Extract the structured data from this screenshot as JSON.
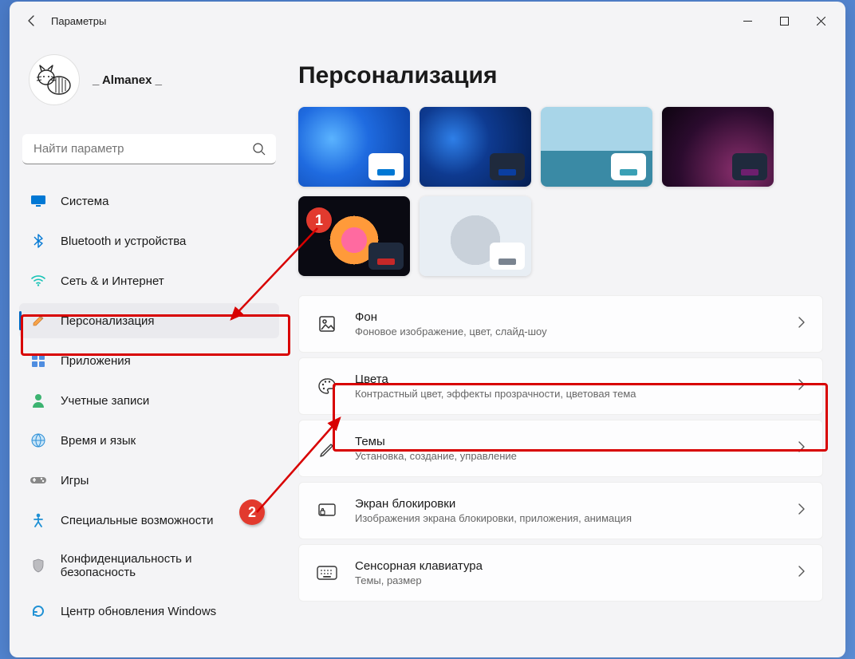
{
  "window": {
    "title": "Параметры",
    "username": "_ Almanex _"
  },
  "search": {
    "placeholder": "Найти параметр"
  },
  "sidebar": {
    "items": [
      {
        "label": "Система",
        "icon": "💻",
        "color": "#0078d4"
      },
      {
        "label": "Bluetooth и устройства",
        "icon": "bt"
      },
      {
        "label": "Сеть & и Интернет",
        "icon": "wifi"
      },
      {
        "label": "Персонализация",
        "icon": "brush"
      },
      {
        "label": "Приложения",
        "icon": "apps"
      },
      {
        "label": "Учетные записи",
        "icon": "user"
      },
      {
        "label": "Время и язык",
        "icon": "globe"
      },
      {
        "label": "Игры",
        "icon": "game"
      },
      {
        "label": "Специальные возможности",
        "icon": "access"
      },
      {
        "label": "Конфиденциальность и безопасность",
        "icon": "shield"
      },
      {
        "label": "Центр обновления Windows",
        "icon": "update"
      }
    ],
    "active_index": 3
  },
  "page": {
    "title": "Персонализация"
  },
  "themes": [
    {
      "bg": "bg-bloom",
      "taskbar": "light",
      "accent": "#0078d4"
    },
    {
      "bg": "bg-bloom-dark",
      "taskbar": "dark",
      "accent": "#0a3ea0"
    },
    {
      "bg": "bg-landscape",
      "taskbar": "light",
      "accent": "#3aa0b5"
    },
    {
      "bg": "bg-purple",
      "taskbar": "dark",
      "accent": "#6e1f6e"
    },
    {
      "bg": "bg-flower",
      "taskbar": "dark",
      "accent": "#c62828"
    },
    {
      "bg": "bg-abstract",
      "taskbar": "light",
      "accent": "#7a8490"
    }
  ],
  "settings": [
    {
      "title": "Фон",
      "sub": "Фоновое изображение, цвет, слайд-шоу",
      "icon": "image"
    },
    {
      "title": "Цвета",
      "sub": "Контрастный цвет, эффекты прозрачности, цветовая тема",
      "icon": "palette"
    },
    {
      "title": "Темы",
      "sub": "Установка, создание, управление",
      "icon": "pen"
    },
    {
      "title": "Экран блокировки",
      "sub": "Изображения экрана блокировки, приложения, анимация",
      "icon": "lock"
    },
    {
      "title": "Сенсорная клавиатура",
      "sub": "Темы, размер",
      "icon": "keyboard"
    }
  ],
  "annotations": {
    "badge1": "1",
    "badge2": "2"
  }
}
